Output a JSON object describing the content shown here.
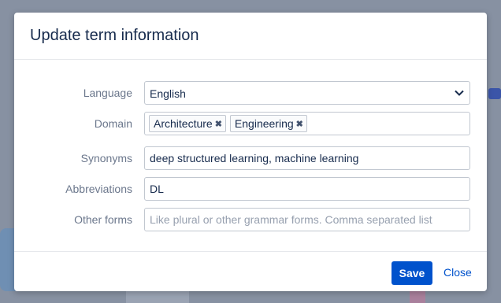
{
  "dialog": {
    "title": "Update term information",
    "fields": {
      "language": {
        "label": "Language",
        "value": "English"
      },
      "domain": {
        "label": "Domain",
        "tags": [
          "Architecture",
          "Engineering"
        ]
      },
      "synonyms": {
        "label": "Synonyms",
        "value": "deep structured learning, machine learning"
      },
      "abbreviations": {
        "label": "Abbreviations",
        "value": "DL"
      },
      "other_forms": {
        "label": "Other forms",
        "value": "",
        "placeholder": "Like plural or other grammar forms. Comma separated list"
      }
    },
    "buttons": {
      "save": "Save",
      "close": "Close"
    }
  },
  "colors": {
    "primary": "#0052cc",
    "overlay": "#8791a2"
  }
}
